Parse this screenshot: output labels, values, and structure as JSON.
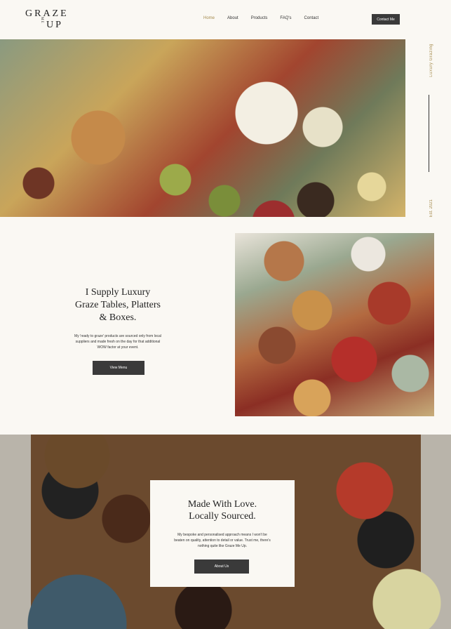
{
  "header": {
    "logo": {
      "line1": "GRAZE",
      "line2": "ME",
      "line3": "UP"
    },
    "nav": [
      "Home",
      "About",
      "Products",
      "FAQ's",
      "Contact"
    ],
    "active_nav": "Home",
    "contact_button": "Contact Me"
  },
  "hero": {
    "side_top": "Luxury Grazing",
    "side_bottom": "Est. 2021"
  },
  "supply": {
    "title_line1": "I Supply Luxury",
    "title_line2": "Graze Tables, Platters",
    "title_line3": "& Boxes.",
    "body": "My 'ready to graze' products are sourced only from local suppliers and made fresh on the day for that additional WOW factor at your event.",
    "button": "View Menu"
  },
  "love": {
    "title_line1": "Made With Love.",
    "title_line2": "Locally Sourced.",
    "body": "My bespoke and personalised approach means I won't be beaten on quality, attention to detail or value. Trust me, there's nothing quite like Graze Me Up.",
    "button": "About Us"
  },
  "colors": {
    "accent": "#a58b4e",
    "button": "#3a3a3a",
    "background": "#faf8f3"
  }
}
